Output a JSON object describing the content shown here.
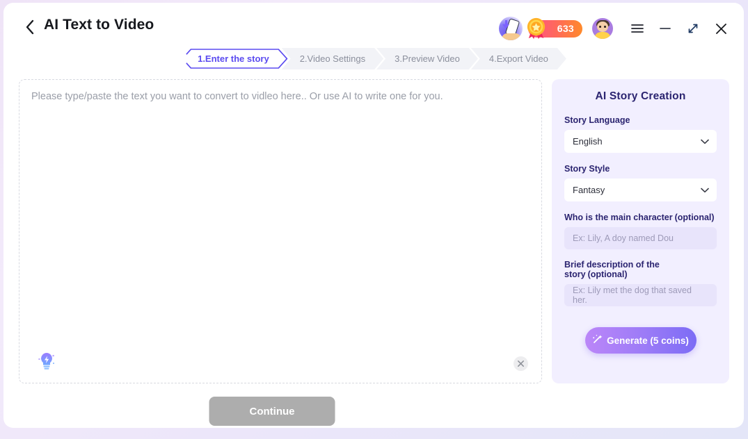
{
  "titlebar": {
    "back_icon": "chevron-left-icon",
    "title": "AI Text to Video",
    "phone_icon": "phone-download-icon",
    "coins": "633",
    "coin_icon": "gold-medal-icon",
    "avatar_icon": "user-avatar",
    "menu_icon": "hamburger-menu-icon",
    "minimize_icon": "minimize-icon",
    "maximize_icon": "expand-icon",
    "close_icon": "close-icon"
  },
  "steps": [
    {
      "label": "1.Enter the story",
      "active": true
    },
    {
      "label": "2.Video Settings",
      "active": false
    },
    {
      "label": "3.Preview Video",
      "active": false
    },
    {
      "label": "4.Export Video",
      "active": false
    }
  ],
  "editor": {
    "placeholder": "Please type/paste the text you want to convert to vidleo here.. Or use AI to write one for you.",
    "value": "",
    "bulb_icon": "lightbulb-ai-icon",
    "clear_icon": "clear-circle-icon"
  },
  "continue": {
    "label": "Continue",
    "enabled": false,
    "color": "#adadad"
  },
  "side_panel": {
    "title": "AI Story Creation",
    "language": {
      "label": "Story Language",
      "value": "English",
      "options": [
        "English"
      ],
      "chevron_icon": "chevron-down-icon"
    },
    "style": {
      "label": "Story Style",
      "value": "Fantasy",
      "options": [
        "Fantasy"
      ],
      "chevron_icon": "chevron-down-icon"
    },
    "main_character": {
      "label": "Who is the main character",
      "optional": "(optional)",
      "value": "",
      "placeholder": "Ex: Lily, A doy named Dou"
    },
    "description": {
      "label": "Brief description of the story",
      "optional": "(optional)",
      "value": "",
      "placeholder": "Ex: Lily met the dog that saved her."
    },
    "generate": {
      "label": "Generate (5 coins)",
      "icon": "sparkle-wand-icon"
    }
  },
  "colors": {
    "accent": "#5b4bf0",
    "panel_bg": "#f2efff",
    "coin_gradient_start": "#ff4d8d",
    "coin_gradient_end": "#ff8a2b"
  }
}
